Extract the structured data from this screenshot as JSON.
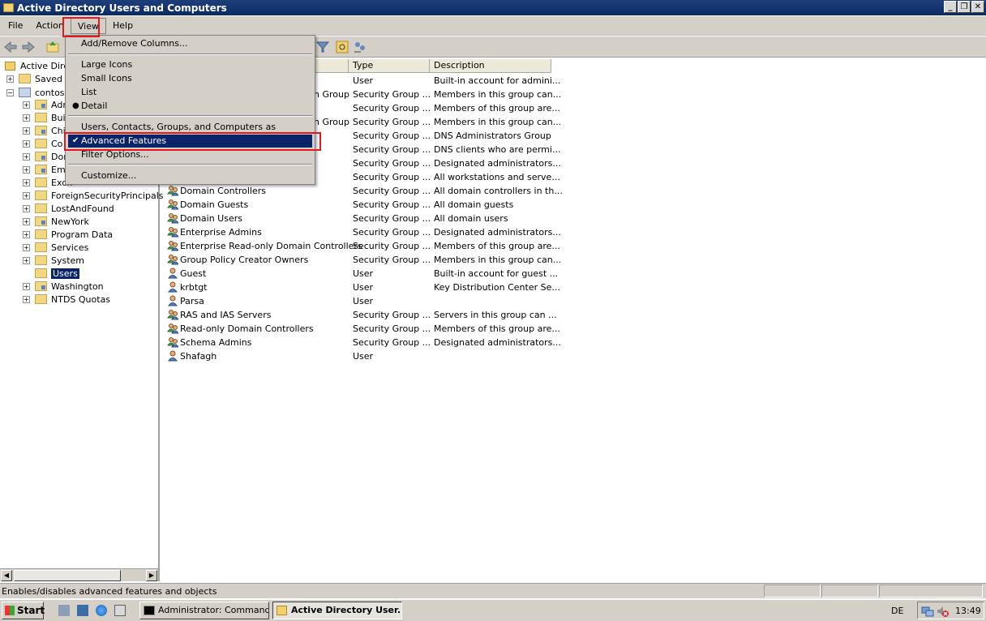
{
  "window": {
    "title": "Active Directory Users and Computers",
    "minimize": "_",
    "restore": "❐",
    "close": "✕"
  },
  "menubar": {
    "items": [
      "File",
      "Action",
      "View",
      "Help"
    ]
  },
  "tree": {
    "root": "Active Directo",
    "saved": "Saved Q",
    "domain": "contoso",
    "items": [
      "Adm",
      "Buil",
      "Chi",
      "Co",
      "Dom",
      "Emp",
      "Exch",
      "ForeignSecurityPrincipals",
      "LostAndFound",
      "NewYork",
      "Program Data",
      "Services",
      "System",
      "Users",
      "Washington",
      "NTDS Quotas"
    ],
    "selected": "Users"
  },
  "list": {
    "columns": [
      "Type",
      "Description"
    ],
    "partial_names": [
      "n Group",
      "n Group"
    ],
    "rows": [
      {
        "name": "",
        "type": "User",
        "desc": "Built-in account for admini..."
      },
      {
        "name": "",
        "type": "Security Group ...",
        "desc": "Members in this group can..."
      },
      {
        "name": "",
        "type": "Security Group ...",
        "desc": "Members of this group are..."
      },
      {
        "name": "",
        "type": "Security Group ...",
        "desc": "Members in this group can..."
      },
      {
        "name": "",
        "type": "Security Group ...",
        "desc": "DNS Administrators Group"
      },
      {
        "name": "",
        "type": "Security Group ...",
        "desc": "DNS clients who are permi..."
      },
      {
        "name": "",
        "type": "Security Group ...",
        "desc": "Designated administrators..."
      },
      {
        "name": "",
        "type": "Security Group ...",
        "desc": "All workstations and serve..."
      },
      {
        "name": "Domain Controllers",
        "type": "Security Group ...",
        "desc": "All domain controllers in th..."
      },
      {
        "name": "Domain Guests",
        "type": "Security Group ...",
        "desc": "All domain guests"
      },
      {
        "name": "Domain Users",
        "type": "Security Group ...",
        "desc": "All domain users"
      },
      {
        "name": "Enterprise Admins",
        "type": "Security Group ...",
        "desc": "Designated administrators..."
      },
      {
        "name": "Enterprise Read-only Domain Controllers",
        "type": "Security Group ...",
        "desc": "Members of this group are..."
      },
      {
        "name": "Group Policy Creator Owners",
        "type": "Security Group ...",
        "desc": "Members in this group can..."
      },
      {
        "name": "Guest",
        "type": "User",
        "desc": "Built-in account for guest ..."
      },
      {
        "name": "krbtgt",
        "type": "User",
        "desc": "Key Distribution Center Se..."
      },
      {
        "name": "Parsa",
        "type": "User",
        "desc": ""
      },
      {
        "name": "RAS and IAS Servers",
        "type": "Security Group ...",
        "desc": "Servers in this group can ..."
      },
      {
        "name": "Read-only Domain Controllers",
        "type": "Security Group ...",
        "desc": "Members of this group are..."
      },
      {
        "name": "Schema Admins",
        "type": "Security Group ...",
        "desc": "Designated administrators..."
      },
      {
        "name": "Shafagh",
        "type": "User",
        "desc": ""
      }
    ]
  },
  "view_menu": {
    "add_remove": "Add/Remove Columns...",
    "large_icons": "Large Icons",
    "small_icons": "Small Icons",
    "list": "List",
    "detail": "Detail",
    "containers": "Users, Contacts, Groups, and Computers as containers",
    "advanced": "Advanced Features",
    "filter": "Filter Options...",
    "customize": "Customize...",
    "check_mark": "✔",
    "radio_mark": "●"
  },
  "statusbar": {
    "text": "Enables/disables advanced features and objects"
  },
  "taskbar": {
    "start": "Start",
    "tasks": [
      "Administrator: Command...",
      "Active Directory User..."
    ],
    "lang": "DE",
    "clock": "13:49"
  }
}
